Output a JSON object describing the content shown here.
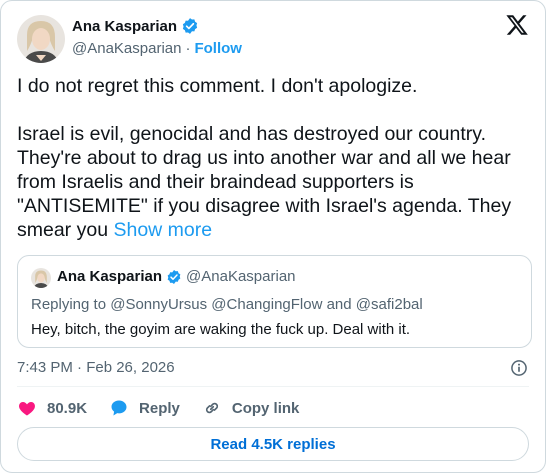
{
  "author": {
    "name": "Ana Kasparian",
    "handle": "@AnaKasparian",
    "separator": "·",
    "follow_label": "Follow"
  },
  "tweet": {
    "line1": "I do not regret this comment. I don't apologize.",
    "paragraph2": "Israel is evil, genocidal and has destroyed our country. They're about to drag us into another war and all we hear from Israelis and their braindead supporters is \"ANTISEMITE\" if you disagree with Israel's agenda. They smear you",
    "show_more": "Show more"
  },
  "quote": {
    "name": "Ana Kasparian",
    "handle": "@AnaKasparian",
    "replying_to": "Replying to @SonnyUrsus @ChangingFlow and @safi2bal",
    "text": "Hey, bitch, the goyim are waking the fuck up. Deal with it."
  },
  "meta": {
    "timestamp": "7:43 PM · Feb 26, 2026"
  },
  "actions": {
    "likes": "80.9K",
    "reply_label": "Reply",
    "copy_link_label": "Copy link"
  },
  "read_replies_label": "Read 4.5K replies",
  "colors": {
    "accent": "#1d9bf0",
    "like": "#f91880",
    "text": "#0f1419",
    "muted": "#536471",
    "border": "#cfd9de"
  },
  "icons": {
    "verified": "verified-badge-icon",
    "logo": "x-logo-icon",
    "info": "info-icon",
    "like": "heart-icon",
    "reply": "reply-bubble-icon",
    "copy_link": "link-icon"
  }
}
